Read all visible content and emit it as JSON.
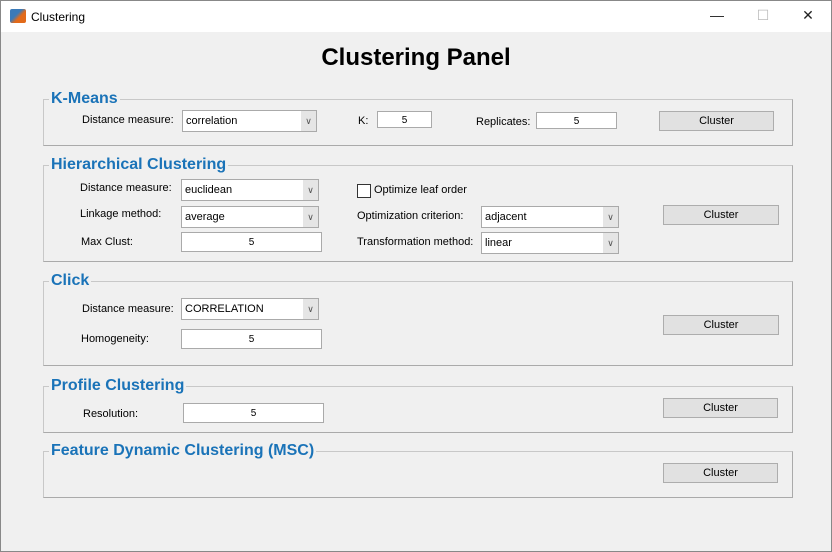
{
  "window": {
    "title": "Clustering",
    "minimize": "—",
    "maximize": "☐",
    "close": "✕"
  },
  "page_title": "Clustering Panel",
  "kmeans": {
    "title": "K-Means",
    "distance_label": "Distance measure:",
    "distance_value": "correlation",
    "k_label": "K:",
    "k_value": "5",
    "replicates_label": "Replicates:",
    "replicates_value": "5",
    "button": "Cluster"
  },
  "hierarchical": {
    "title": "Hierarchical Clustering",
    "distance_label": "Distance measure:",
    "distance_value": "euclidean",
    "linkage_label": "Linkage method:",
    "linkage_value": "average",
    "maxclust_label": "Max Clust:",
    "maxclust_value": "5",
    "optimize_label": "Optimize leaf order",
    "optimize_checked": false,
    "criterion_label": "Optimization criterion:",
    "criterion_value": "adjacent",
    "transform_label": "Transformation method:",
    "transform_value": "linear",
    "button": "Cluster"
  },
  "click": {
    "title": "Click",
    "distance_label": "Distance measure:",
    "distance_value": "CORRELATION",
    "homogeneity_label": "Homogeneity:",
    "homogeneity_value": "5",
    "button": "Cluster"
  },
  "profile": {
    "title": "Profile Clustering",
    "resolution_label": "Resolution:",
    "resolution_value": "5",
    "button": "Cluster"
  },
  "msc": {
    "title": "Feature Dynamic Clustering (MSC)",
    "button": "Cluster"
  },
  "colors": {
    "section_title": "#1a73b8"
  }
}
